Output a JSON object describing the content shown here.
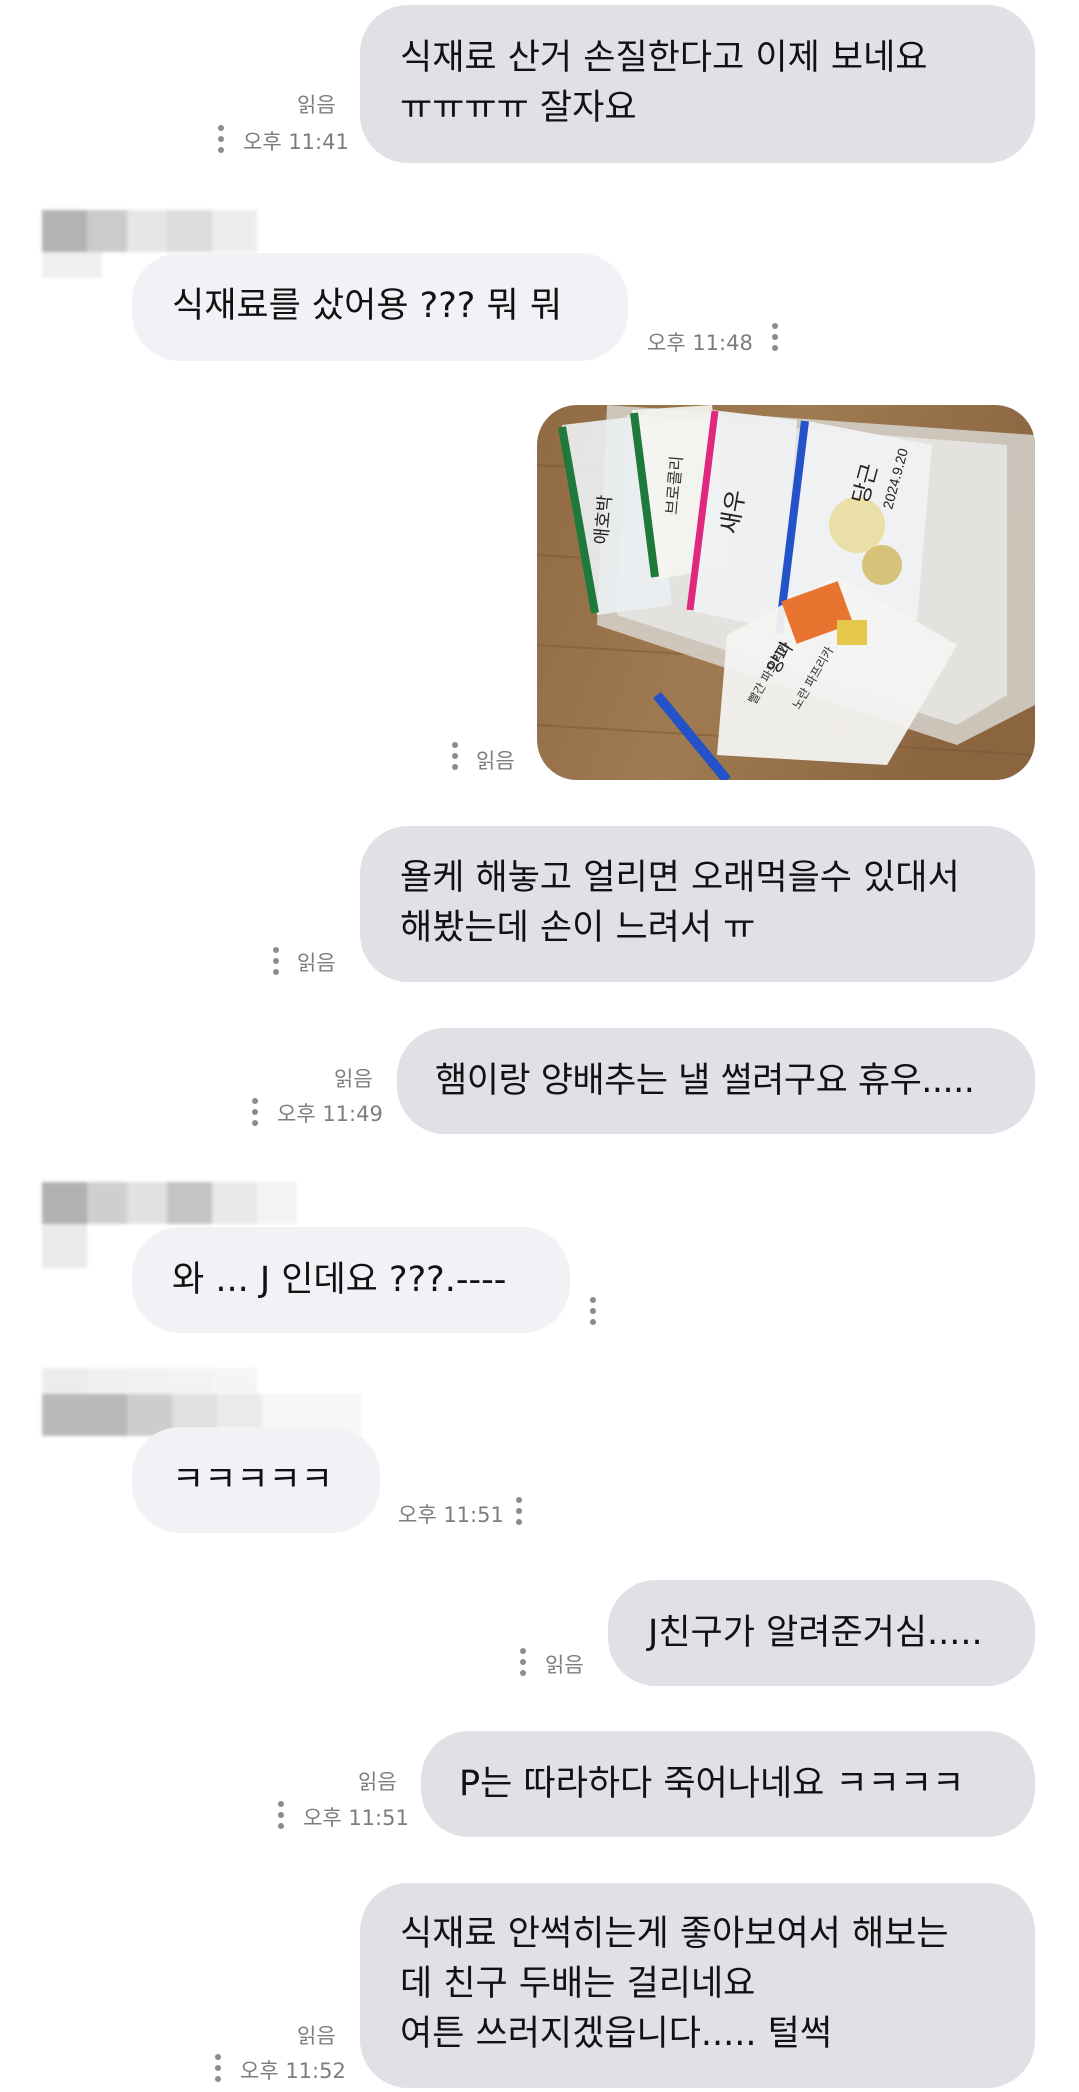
{
  "messages": [
    {
      "id": "m1",
      "side": "sent",
      "lines": [
        "식재료 산거 손질한다고 이제 보네요",
        "ㅠㅠㅠㅠ 잘자요"
      ],
      "read": "읽음",
      "time": "오후 11:41"
    },
    {
      "id": "m2",
      "side": "recv",
      "lines": [
        "식재료를 샀어용 ??? 뭐 뭐"
      ],
      "time": "오후 11:48"
    },
    {
      "id": "m3",
      "side": "sent",
      "type": "image",
      "read": "읽음",
      "bag_labels": [
        "애호박",
        "브로콜리",
        "새우",
        "당근",
        "2024.9.20",
        "양파",
        "빨간 파프리카",
        "노란 파프리카"
      ]
    },
    {
      "id": "m4",
      "side": "sent",
      "lines": [
        "욜케 해놓고 얼리면 오래먹을수 있대서",
        "해봤는데 손이 느려서 ㅠ"
      ],
      "read": "읽음"
    },
    {
      "id": "m5",
      "side": "sent",
      "lines": [
        "햄이랑 양배추는 낼 썰려구요 휴우....."
      ],
      "read": "읽음",
      "time": "오후 11:49"
    },
    {
      "id": "m6",
      "side": "recv",
      "lines": [
        "와 ... J 인데요 ???.----"
      ]
    },
    {
      "id": "m7",
      "side": "recv",
      "lines": [
        "ㅋㅋㅋㅋㅋ"
      ],
      "time": "오후 11:51"
    },
    {
      "id": "m8",
      "side": "sent",
      "lines": [
        "J친구가 알려준거심....."
      ],
      "read": "읽음"
    },
    {
      "id": "m9",
      "side": "sent",
      "lines": [
        "P는 따라하다 죽어나네요 ㅋㅋㅋㅋ"
      ],
      "read": "읽음",
      "time": "오후 11:51"
    },
    {
      "id": "m10",
      "side": "sent",
      "lines": [
        "식재료 안썩히는게 좋아보여서 해보는",
        "데 친구 두배는 걸리네요",
        "여튼 쓰러지겠읍니다..... 털썩"
      ],
      "read": "읽음",
      "time": "오후 11:52"
    }
  ],
  "colors": {
    "background": "#ffffff",
    "sent_bubble": "#dfe1e6",
    "received_bubble": "#f1f2f6",
    "meta_text": "#7d7d7d",
    "dots": "#8c8c8c"
  },
  "icons": {
    "more_options": "vertical-ellipsis-icon",
    "sender_name": "blurred-name"
  }
}
